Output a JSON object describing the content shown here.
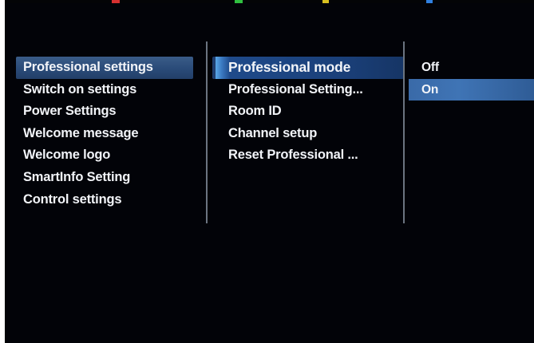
{
  "menu": {
    "column1": {
      "items": [
        {
          "label": "Professional settings",
          "selected": true
        },
        {
          "label": "Switch on settings",
          "selected": false
        },
        {
          "label": "Power Settings",
          "selected": false
        },
        {
          "label": "Welcome message",
          "selected": false
        },
        {
          "label": "Welcome logo",
          "selected": false
        },
        {
          "label": "SmartInfo Setting",
          "selected": false
        },
        {
          "label": "Control settings",
          "selected": false
        }
      ]
    },
    "column2": {
      "items": [
        {
          "label": "Professional mode",
          "selected": true
        },
        {
          "label": "Professional Setting...",
          "selected": false
        },
        {
          "label": "Room ID",
          "selected": false
        },
        {
          "label": "Channel setup",
          "selected": false
        },
        {
          "label": "Reset Professional ...",
          "selected": false
        }
      ]
    },
    "column3": {
      "items": [
        {
          "label": "Off",
          "selected": false
        },
        {
          "label": "On",
          "selected": true
        }
      ]
    }
  },
  "colors": {
    "background": "#020308",
    "text": "#f2f4f8",
    "selection": "#2b4c7a",
    "divider": "#6b7480",
    "color_key_red": "#d63030",
    "color_key_green": "#30c040",
    "color_key_yellow": "#d8c020",
    "color_key_blue": "#3080e0"
  }
}
